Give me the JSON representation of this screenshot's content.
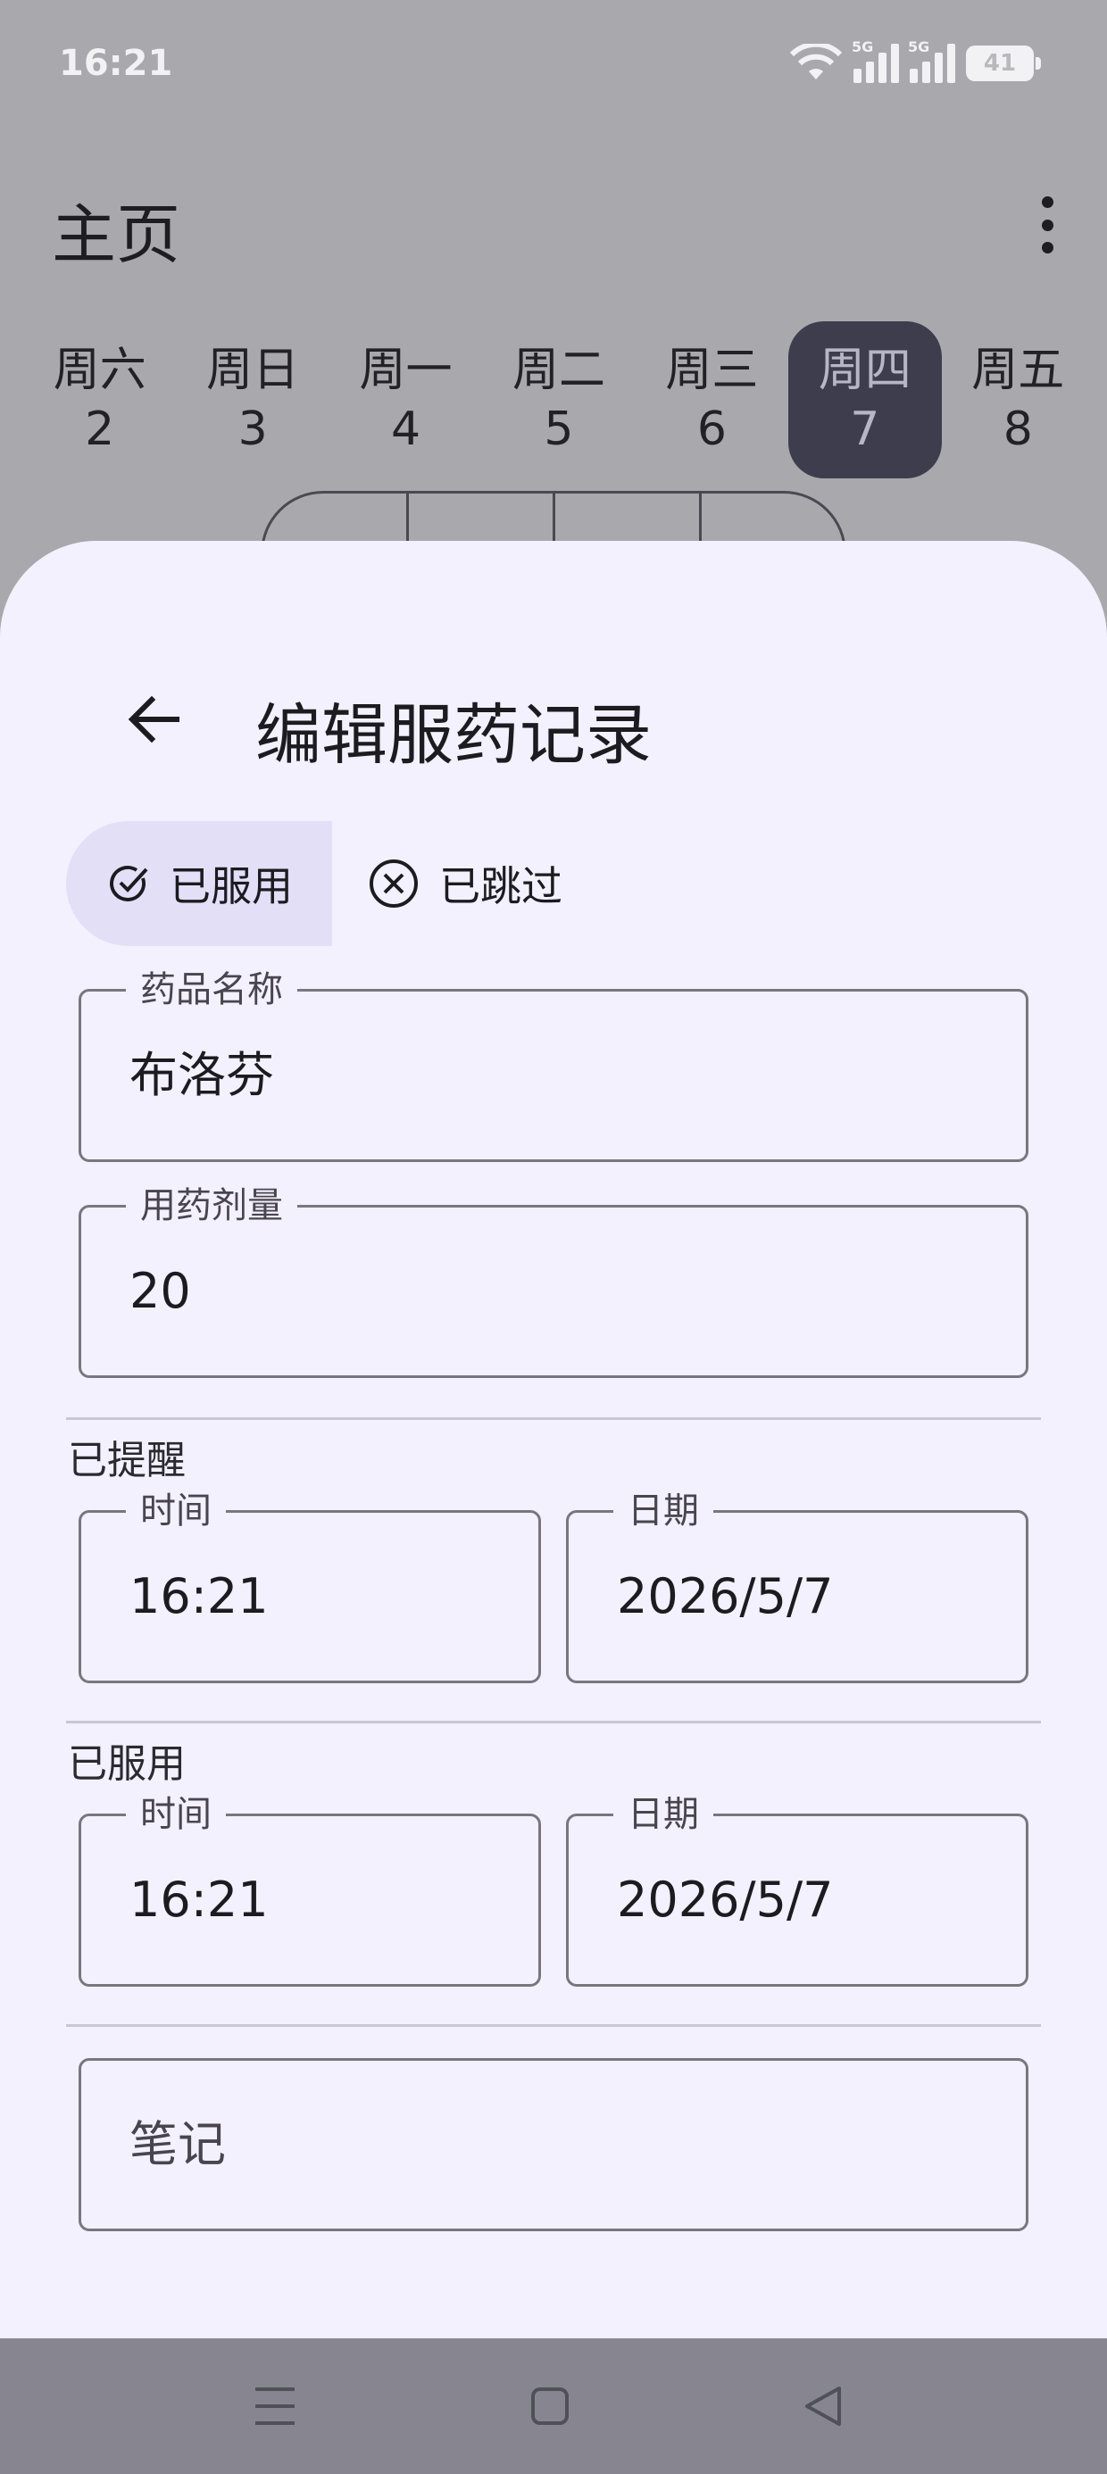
{
  "status_bar": {
    "time": "16:21",
    "signal_1_label": "5G",
    "signal_2_label": "5G",
    "battery": "41",
    "icons": [
      "wifi-icon",
      "signal-icon",
      "signal-icon",
      "battery-icon"
    ]
  },
  "app_bar": {
    "title": "主页",
    "menu_icon": "more-vert-icon"
  },
  "week": {
    "days": [
      {
        "name": "周六",
        "date": "2"
      },
      {
        "name": "周日",
        "date": "3"
      },
      {
        "name": "周一",
        "date": "4"
      },
      {
        "name": "周二",
        "date": "5"
      },
      {
        "name": "周三",
        "date": "6"
      },
      {
        "name": "周四",
        "date": "7",
        "selected": true
      },
      {
        "name": "周五",
        "date": "8"
      }
    ]
  },
  "sheet": {
    "back_icon": "arrow-back-icon",
    "title": "编辑服药记录",
    "toggle": {
      "taken_label": "已服用",
      "skipped_label": "已跳过",
      "selected": "taken"
    },
    "medicine_name": {
      "label": "药品名称",
      "value": "布洛芬"
    },
    "dose": {
      "label": "用药剂量",
      "value": "20"
    },
    "reminded": {
      "section_label": "已提醒",
      "time_label": "时间",
      "time_value": "16:21",
      "date_label": "日期",
      "date_value": "2026/5/7"
    },
    "taken": {
      "section_label": "已服用",
      "time_label": "时间",
      "time_value": "16:21",
      "date_label": "日期",
      "date_value": "2026/5/7"
    },
    "notes": {
      "placeholder": "笔记"
    }
  },
  "nav_bar": {
    "icons": [
      "menu-icon",
      "home-icon",
      "back-icon"
    ]
  },
  "colors": {
    "scrim": "#a9a8ad",
    "sheet_bg": "#f2f1fd",
    "chip_selected": "#e2dff7",
    "day_selected": "#3e3d4e",
    "outline": "#79767e",
    "nav_bar": "#878690"
  }
}
